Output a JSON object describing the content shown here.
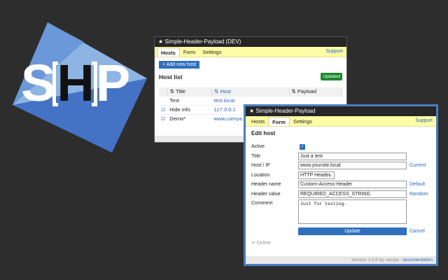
{
  "logo": {
    "s": "S",
    "h": "H",
    "p": "P",
    "colors": {
      "dark": "#4472c4",
      "light": "#8eb4e3"
    }
  },
  "window1": {
    "title": "★ Simple-Header-Payload (DEV)",
    "tabs": [
      {
        "label": "Hosts"
      },
      {
        "label": "Form"
      },
      {
        "label": "Settings"
      }
    ],
    "support": "Support",
    "add_button": "+ Add new host",
    "list_title": "Host list",
    "badge": "Updated",
    "columns": {
      "title": "⇅ Title",
      "host": "⇅ Host",
      "payload": "⇅ Payload"
    },
    "rows": [
      {
        "check": "",
        "title": "Test",
        "host": "test.local"
      },
      {
        "check": "☑",
        "title": "Hide info",
        "host": "127.0.0.1"
      },
      {
        "check": "☑",
        "title": "Demo*",
        "host": "www.camya.com"
      }
    ]
  },
  "window2": {
    "title": "★ Simple-Header-Payload",
    "tabs": [
      {
        "label": "Hosts"
      },
      {
        "label": "Form"
      },
      {
        "label": "Settings"
      }
    ],
    "support": "Support",
    "heading": "Edit host",
    "fields": {
      "active_label": "Active",
      "title_label": "Title",
      "title_value": "Just a test",
      "host_label": "Host / IP",
      "host_value": "www.yoursite.local",
      "host_action": "Current",
      "location_label": "Location",
      "location_value": "HTTP Header",
      "header_name_label": "Header name",
      "header_name_value": "Custom-Access-Header",
      "header_name_action": "Default",
      "header_value_label": "Header value",
      "header_value_value": "REQUIRED_ACCESS_STRING",
      "header_value_action": "Random",
      "comment_label": "Comment",
      "comment_value": "Just for testing."
    },
    "update_button": "Update",
    "cancel": "Cancel",
    "delete": "✕ Delete",
    "footer_text": "Version 1.0.0 by camya - ",
    "footer_link": "documentation"
  }
}
